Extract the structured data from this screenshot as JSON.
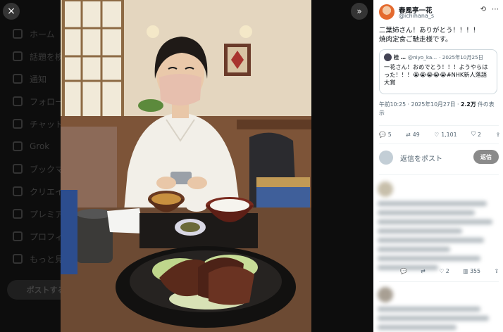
{
  "modal": {
    "close_icon": "×",
    "expand_icon": "»"
  },
  "background_nav": {
    "items": [
      "ホーム",
      "話題を検索",
      "通知",
      "フォロー",
      "チャット",
      "Grok",
      "ブックマーク",
      "クリエイター",
      "プレミアム",
      "プロフィール",
      "もっと見る"
    ],
    "post_label": "ポストする"
  },
  "tweet": {
    "author_name": "春風亭一花",
    "author_handle": "@ichihana_s",
    "text": "二葉姉さん！ありがとう！！！！\n焼肉定食ご馳走様です。",
    "quote": {
      "author_name": "桂 …",
      "author_handle": "@niyo_ka...",
      "date": "· 2025年10月25日",
      "text": "一花さん！おめでとう！！！ようやらはった！！！😭😭😭😭😭#NHK新人落語大賞"
    },
    "timestamp": "午前10:25 · 2025年10月27日 · ",
    "views_count": "2.2万",
    "views_suffix": " 件の表",
    "views_suffix2": "示",
    "actions": {
      "reply_count": "5",
      "repost_count": "49",
      "like_count": "1,101",
      "bookmark_count": "2"
    }
  },
  "reply_box": {
    "placeholder": "返信をポスト",
    "button_label": "返信"
  },
  "reply_actions": {
    "repost_count": "",
    "like_count": "2",
    "view_count": "355"
  }
}
